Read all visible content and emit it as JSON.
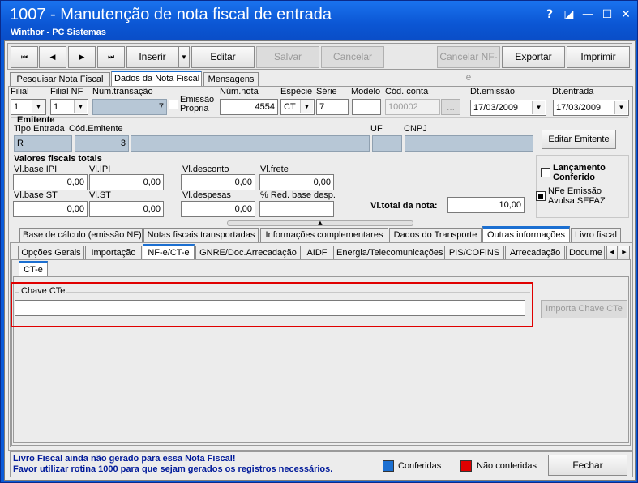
{
  "window": {
    "title": "1007 - Manutenção de nota fiscal de entrada",
    "subtitle": "Winthor - PC Sistemas",
    "help": "?",
    "restore": "◪",
    "minimize": "—",
    "maximize": "☐",
    "close": "✕"
  },
  "toolbar": {
    "first": "⏮",
    "prev": "◀",
    "next": "▶",
    "last": "⏭",
    "inserir": "Inserir",
    "inserir_dd": "▼",
    "editar": "Editar",
    "salvar": "Salvar",
    "cancelar": "Cancelar",
    "cancelar_nfe": "Cancelar NF-e",
    "exportar": "Exportar",
    "imprimir": "Imprimir"
  },
  "main_tabs": [
    "Pesquisar Nota Fiscal",
    "Dados da Nota Fiscal",
    "Mensagens"
  ],
  "fields": {
    "filial_label": "Filial",
    "filial": "1",
    "filial_nf_label": "Filial NF",
    "filial_nf": "1",
    "num_transacao_label": "Núm.transação",
    "num_transacao": "7",
    "emissao_propria_label": "Emissão\nPrópria",
    "num_nota_label": "Núm.nota",
    "num_nota": "4554",
    "especie_label": "Espécie",
    "especie": "CT",
    "serie_label": "Série",
    "serie": "7",
    "modelo_label": "Modelo",
    "modelo": "",
    "cod_conta_label": "Cód. conta",
    "cod_conta": "100002",
    "cod_conta_btn": "...",
    "dt_emissao_label": "Dt.emissão",
    "dt_emissao": "17/03/2009",
    "dt_entrada_label": "Dt.entrada",
    "dt_entrada": "17/03/2009"
  },
  "emitente": {
    "title": "Emitente",
    "tipo_entrada_label": "Tipo Entrada",
    "tipo_entrada": "R",
    "cod_emitente_label": "Cód.Emitente",
    "cod_emitente": "3",
    "uf_label": "UF",
    "cnpj_label": "CNPJ",
    "editar_btn": "Editar Emitente"
  },
  "valores": {
    "title": "Valores fiscais totais",
    "vl_base_ipi_label": "Vl.base IPI",
    "vl_base_ipi": "0,00",
    "vl_ipi_label": "Vl.IPI",
    "vl_ipi": "0,00",
    "vl_desconto_label": "Vl.desconto",
    "vl_desconto": "0,00",
    "vl_frete_label": "Vl.frete",
    "vl_frete": "0,00",
    "vl_base_st_label": "Vl.base ST",
    "vl_base_st": "0,00",
    "vl_st_label": "Vl.ST",
    "vl_st": "0,00",
    "vl_despesas_label": "Vl.despesas",
    "vl_despesas": "0,00",
    "red_base_label": "% Red. base desp.",
    "red_base": "",
    "vl_total_label": "Vl.total da nota:",
    "vl_total": "10,00"
  },
  "side": {
    "lancamento_label": "Lançamento\nConferido",
    "nfe_label": "NFe Emissão\nAvulsa SEFAZ"
  },
  "tabs_row1": [
    "Base de cálculo (emissão NF)",
    "Notas fiscais transportadas",
    "Informações complementares",
    "Dados do Transporte",
    "Outras informações",
    "Livro fiscal"
  ],
  "tabs_row2": [
    "Opções Gerais",
    "Importação",
    "NF-e/CT-e",
    "GNRE/Doc.Arrecadação",
    "AIDF",
    "Energia/Telecomunicações",
    "PIS/COFINS",
    "Arrecadação",
    "Docume"
  ],
  "tabs_row3": [
    "CT-e"
  ],
  "cte": {
    "chave_label": "Chave CTe",
    "chave_value": "",
    "importa_btn": "Importa Chave CTe"
  },
  "footer": {
    "msg1": "Livro Fiscal ainda não gerado para essa Nota Fiscal!",
    "msg2": "Favor utilizar rotina 1000 para que sejam gerados os registros necessários.",
    "conferidas": "Conferidas",
    "nao_conferidas": "Não conferidas",
    "fechar": "Fechar"
  },
  "colors": {
    "conferidas": "#1b6fd1",
    "nao_conferidas": "#e00000",
    "highlight": "#e00000",
    "footer_text": "#001a9a"
  }
}
